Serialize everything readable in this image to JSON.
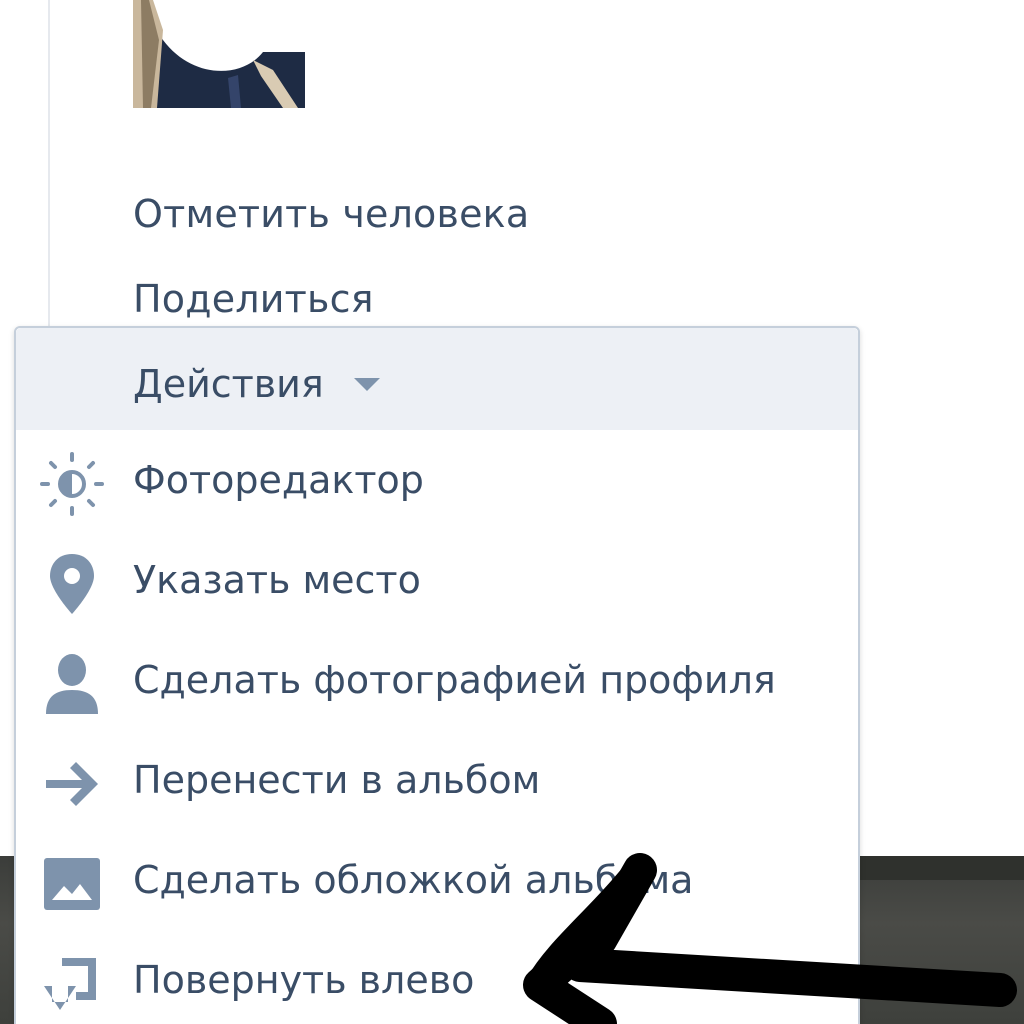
{
  "links": {
    "tag_person": "Отметить человека",
    "share": "Поделиться"
  },
  "menu": {
    "header_label": "Действия",
    "items": [
      {
        "label": "Фоторедактор",
        "icon": "sun-icon"
      },
      {
        "label": "Указать место",
        "icon": "location-pin-icon"
      },
      {
        "label": "Сделать фотографией профиля",
        "icon": "user-icon"
      },
      {
        "label": "Перенести в альбом",
        "icon": "arrow-right-icon"
      },
      {
        "label": "Сделать обложкой альбома",
        "icon": "image-icon"
      },
      {
        "label": "Повернуть влево",
        "icon": "rotate-left-icon"
      }
    ]
  },
  "colors": {
    "link_text": "#3a4d66",
    "icon": "#7e93ac",
    "menu_header_bg": "#edf0f5",
    "menu_border": "#c5cfdb"
  }
}
